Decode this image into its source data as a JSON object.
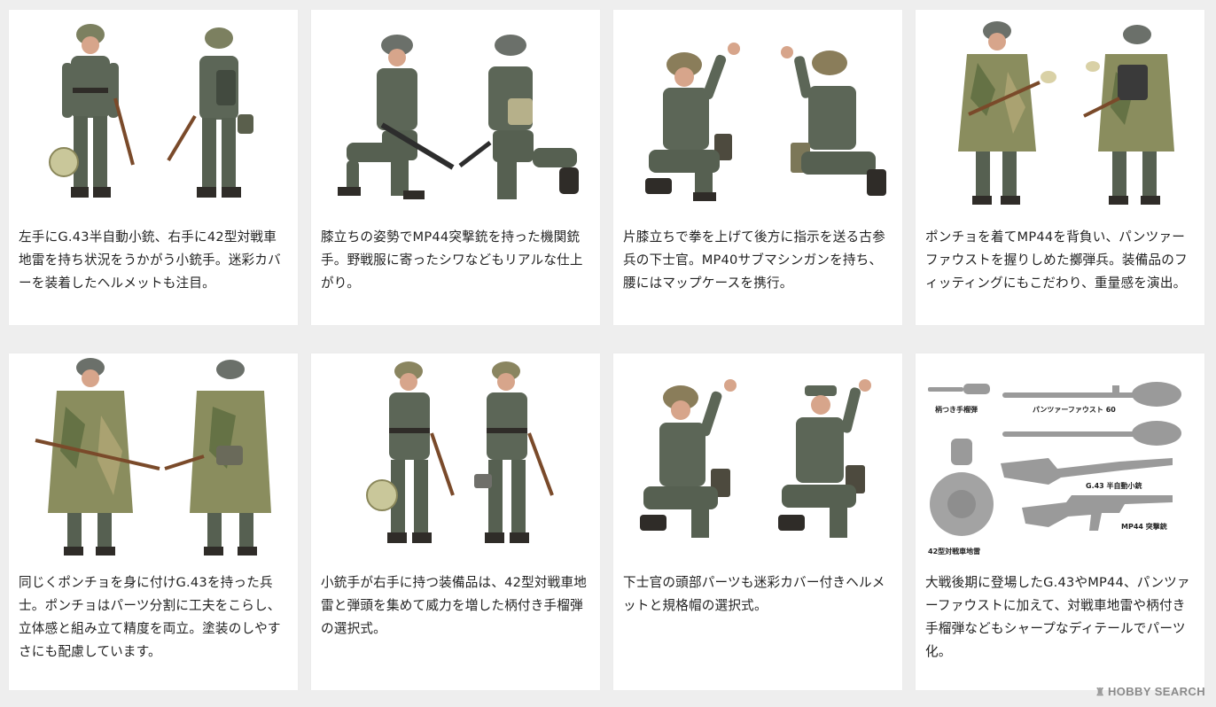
{
  "cards": [
    {
      "caption": "左手にG.43半自動小銃、右手に42型対戦車地雷を持ち状況をうかがう小銃手。迷彩カバーを装着したヘルメットも注目。"
    },
    {
      "caption": "膝立ちの姿勢でMP44突撃銃を持った機関銃手。野戦服に寄ったシワなどもリアルな仕上がり。"
    },
    {
      "caption": "片膝立ちで拳を上げて後方に指示を送る古参兵の下士官。MP40サブマシンガンを持ち、腰にはマップケースを携行。"
    },
    {
      "caption": "ポンチョを着てMP44を背負い、パンツァーファウストを握りしめた擲弾兵。装備品のフィッティングにもこだわり、重量感を演出。"
    },
    {
      "caption": "同じくポンチョを身に付けG.43を持った兵士。ポンチョはパーツ分割に工夫をこらし、立体感と組み立て精度を両立。塗装のしやすさにも配慮しています。"
    },
    {
      "caption": "小銃手が右手に持つ装備品は、42型対戦車地雷と弾頭を集めて威力を増した柄付き手榴弾の選択式。"
    },
    {
      "caption": "下士官の頭部パーツも迷彩カバー付きヘルメットと規格帽の選択式。"
    },
    {
      "caption": "大戦後期に登場したG.43やMP44、パンツァーファウストに加えて、対戦車地雷や柄付き手榴弾などもシャープなディテールでパーツ化。",
      "parts": {
        "grenade": "柄つき手榴弾",
        "panzerfaust": "パンツァーファウスト 60",
        "g43": "G.43 半自動小銃",
        "mine": "42型対戦車地雷",
        "mp44": "MP44 突撃銃"
      }
    }
  ],
  "watermark": {
    "brand": "HOBBY SEARCH"
  },
  "colors": {
    "uniform": "#5c6657",
    "uniform_dark": "#424a3f",
    "camo": "#8a8d5e",
    "helmet": "#6b706a",
    "skin": "#d7a58b",
    "boots": "#2f2c28",
    "wood": "#7a4a2a",
    "metal": "#3a3a3a",
    "parts_grey": "#9a9a9a"
  }
}
